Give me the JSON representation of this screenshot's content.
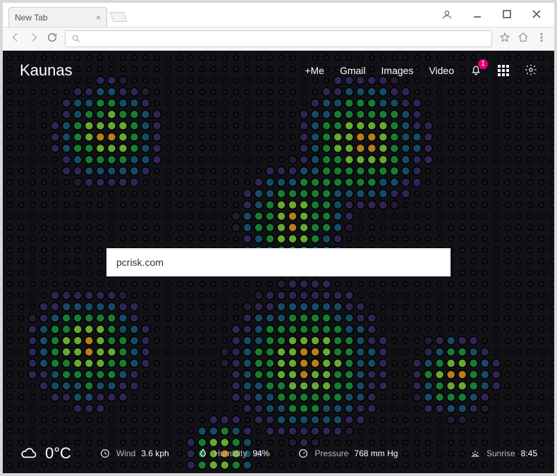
{
  "browser": {
    "tab_title": "New Tab",
    "account_tooltip": "Account"
  },
  "topbar": {
    "location": "Kaunas",
    "links": {
      "me": "+Me",
      "gmail": "Gmail",
      "images": "Images",
      "video": "Video"
    },
    "notification_count": "1"
  },
  "search": {
    "value": "pcrisk.com"
  },
  "weather": {
    "temp": "0°C",
    "wind_label": "Wind",
    "wind_value": "3.6 kph",
    "humidity_label": "Humidity",
    "humidity_value": "94%",
    "pressure_label": "Pressure",
    "pressure_value": "768 mm Hg",
    "sunrise_label": "Sunrise",
    "sunrise_value": "8:45"
  }
}
